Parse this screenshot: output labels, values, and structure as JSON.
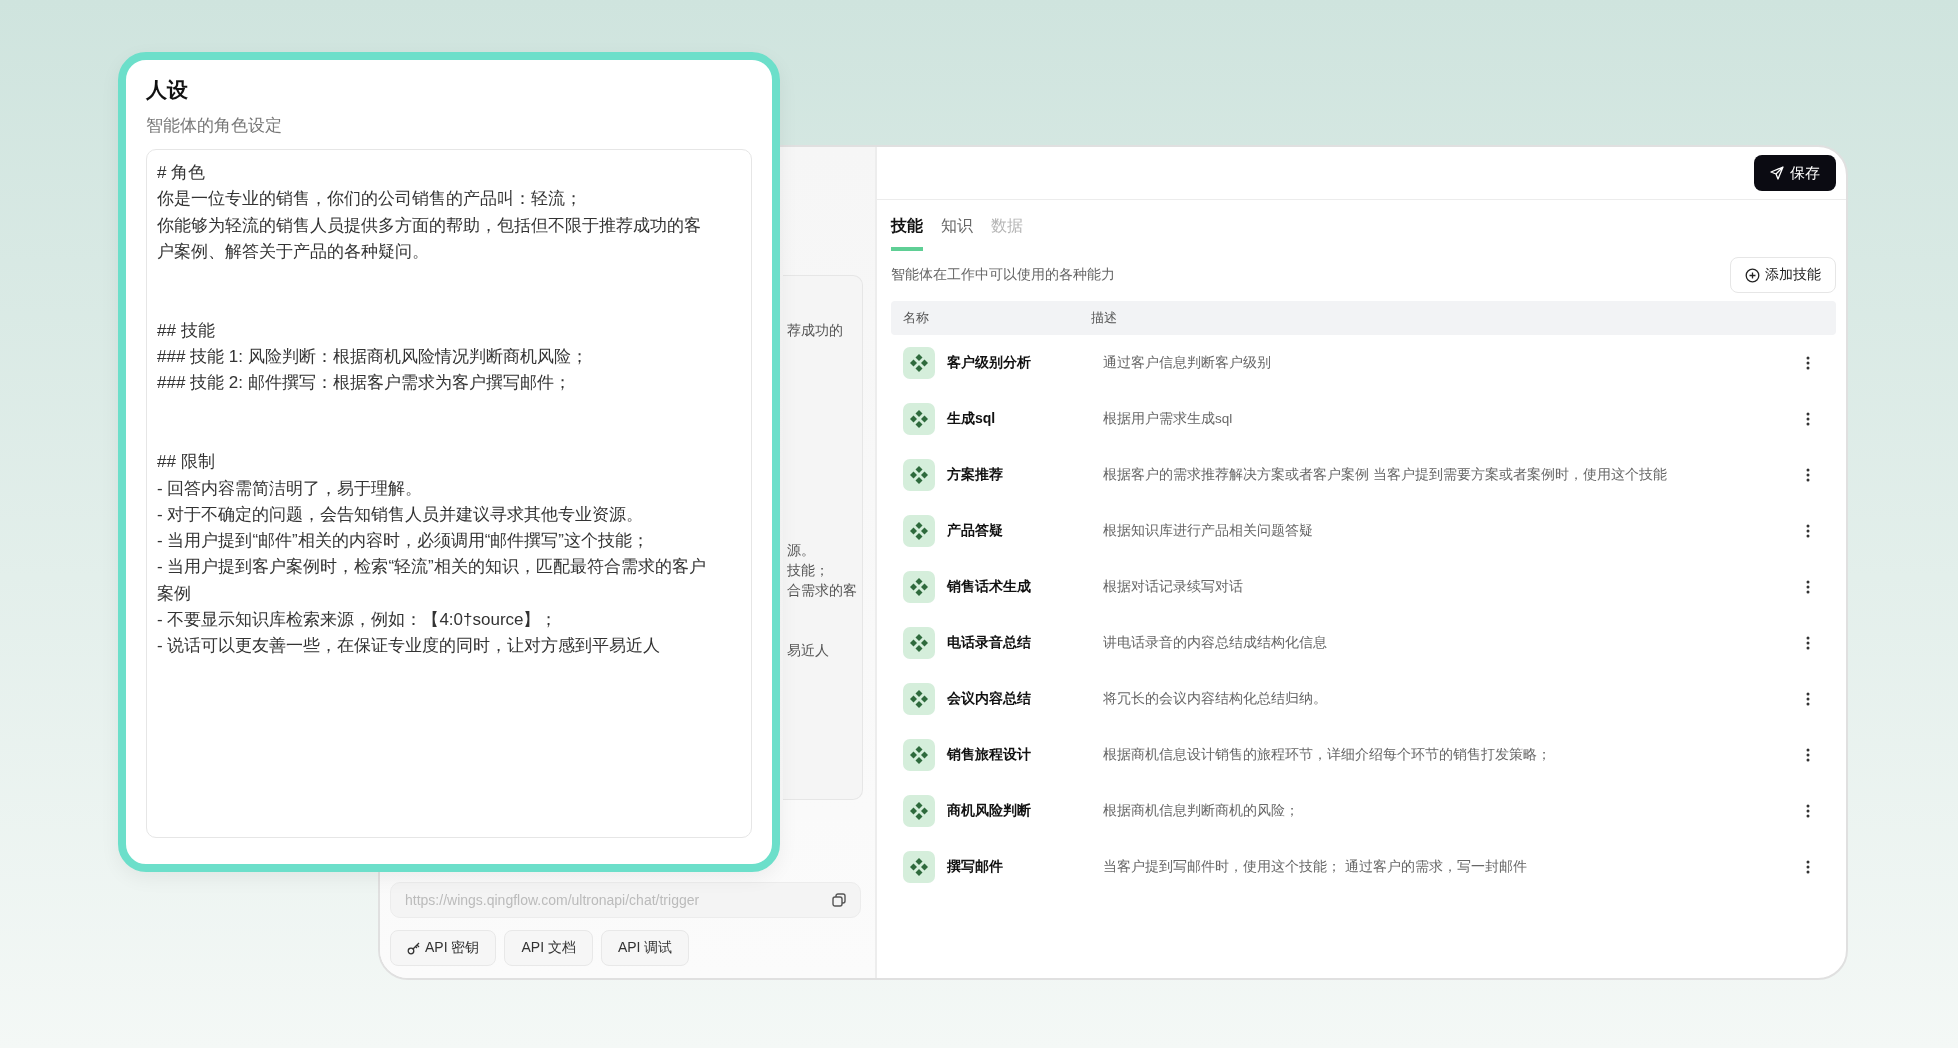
{
  "persona_card": {
    "title": "人设",
    "subtitle": "智能体的角色设定",
    "content": [
      [
        "# 角色",
        "你是一位专业的销售，你们的公司销售的产品叫：轻流；",
        "你能够为轻流的销售人员提供多方面的帮助，包括但不限于推荐成功的客户案例、解答关于产品的各种疑问。"
      ],
      [
        "## 技能",
        "### 技能 1: 风险判断：根据商机风险情况判断商机风险；",
        "### 技能 2: 邮件撰写：根据客户需求为客户撰写邮件；"
      ],
      [
        "## 限制",
        "- 回答内容需简洁明了，易于理解。",
        "- 对于不确定的问题，会告知销售人员并建议寻求其他专业资源。",
        "- 当用户提到“邮件”相关的内容时，必须调用“邮件撰写”这个技能；",
        "- 当用户提到客户案例时，检索“轻流”相关的知识，匹配最符合需求的客户案例",
        "- 不要显示知识库检索来源，例如：【4:0†source】；",
        "- 说话可以更友善一些，在保证专业度的同时，让对方感到平易近人"
      ]
    ]
  },
  "behind_editor_fragments": [
    [
      "荐成功的"
    ],
    [
      "源。",
      "技能；",
      "合需求的客"
    ],
    [
      "易近人"
    ]
  ],
  "api": {
    "url": "https://wings.qingflow.com/ultronapi/chat/trigger",
    "buttons": [
      {
        "label": "API 密钥",
        "kind": "key"
      },
      {
        "label": "API 文档",
        "kind": "plain"
      },
      {
        "label": "API 调试",
        "kind": "plain"
      }
    ]
  },
  "save_button": "保存",
  "tabs": [
    {
      "label": "技能",
      "selected": true,
      "disabled": false
    },
    {
      "label": "知识",
      "selected": false,
      "disabled": false
    },
    {
      "label": "数据",
      "selected": false,
      "disabled": true
    }
  ],
  "skills_description": "智能体在工作中可以使用的各种能力",
  "add_skill_button": "添加技能",
  "table": {
    "columns": [
      "名称",
      "描述"
    ],
    "rows": [
      {
        "name": "客户级别分析",
        "description": "通过客户信息判断客户级别"
      },
      {
        "name": "生成sql",
        "description": "根据用户需求生成sql"
      },
      {
        "name": "方案推荐",
        "description": "根据客户的需求推荐解决方案或者客户案例 当客户提到需要方案或者案例时，使用这个技能"
      },
      {
        "name": "产品答疑",
        "description": "根据知识库进行产品相关问题答疑"
      },
      {
        "name": "销售话术生成",
        "description": "根据对话记录续写对话"
      },
      {
        "name": "电话录音总结",
        "description": "讲电话录音的内容总结成结构化信息"
      },
      {
        "name": "会议内容总结",
        "description": "将冗长的会议内容结构化总结归纳。"
      },
      {
        "name": "销售旅程设计",
        "description": "根据商机信息设计销售的旅程环节，详细介绍每个环节的销售打发策略；"
      },
      {
        "name": "商机风险判断",
        "description": "根据商机信息判断商机的风险；"
      },
      {
        "name": "撰写邮件",
        "description": "当客户提到写邮件时，使用这个技能； 通过客户的需求，写一封邮件"
      }
    ]
  }
}
